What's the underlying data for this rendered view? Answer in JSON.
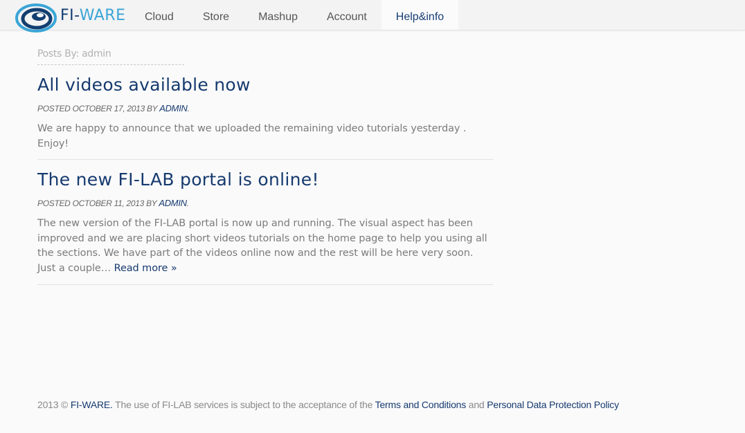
{
  "logo": {
    "text_fi": "FI-",
    "text_ware": "WARE"
  },
  "nav": {
    "items": [
      {
        "label": "Cloud",
        "active": false
      },
      {
        "label": "Store",
        "active": false
      },
      {
        "label": "Mashup",
        "active": false
      },
      {
        "label": "Account",
        "active": false
      },
      {
        "label": "Help&info",
        "active": true
      }
    ]
  },
  "page": {
    "posts_by": "Posts By: admin"
  },
  "posts": [
    {
      "title": "All videos available now",
      "meta_prefix": "Posted October 17, 2013 by",
      "author": "admin",
      "meta_suffix": ".",
      "body": "We are happy to announce that we uploaded the remaining video tutorials yesterday . Enjoy!",
      "read_more": ""
    },
    {
      "title": "The new FI-LAB portal is online!",
      "meta_prefix": "Posted October 11, 2013 by",
      "author": "admin",
      "meta_suffix": ".",
      "body": "The new version of the FI-LAB portal is now up and running. The visual aspect has been improved and we are placing short videos tutorials on the home page to help you using all the sections. We have part of the videos online now and the rest will be here very soon. Just a couple…",
      "read_more": "Read more »"
    }
  ],
  "footer": {
    "year": "2013 ©",
    "brand": "FI-WARE.",
    "text": "The use of FI-LAB services is subject to the acceptance of the",
    "terms": "Terms and Conditions",
    "and": "and",
    "privacy": "Personal Data Protection Policy"
  },
  "colors": {
    "brand_dark": "#163a6e",
    "brand_light": "#3aa5d6",
    "background": "#fafafb"
  }
}
